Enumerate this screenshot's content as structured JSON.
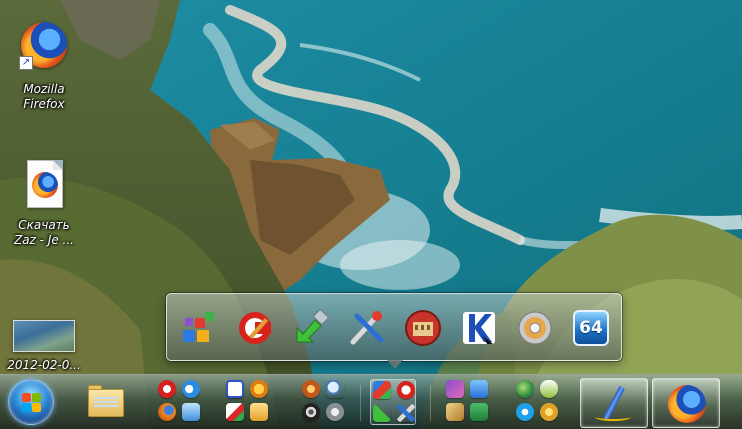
{
  "desktop": {
    "icons": [
      {
        "id": "firefox",
        "label_line1": "Mozilla",
        "label_line2": "Firefox"
      },
      {
        "id": "download",
        "label_line1": "Скачать",
        "label_line2": "Zaz - Je ..."
      },
      {
        "id": "photo",
        "label_line1": "2012-02-0...",
        "label_line2": ""
      }
    ]
  },
  "taskbar": {
    "start_button": "start-orb-icon",
    "pinned_folder": "explorer-folder-icon",
    "groups": [
      {
        "id": "browsers",
        "icons": [
          "opera-icon",
          "internet-explorer-icon",
          "firefox-icon",
          "audio-icon"
        ]
      },
      {
        "id": "tools",
        "icons": [
          "daemon-tools-icon",
          "aimp-icon",
          "pdf-icon",
          "archive-icon"
        ]
      },
      {
        "id": "media",
        "icons": [
          "media-player-icon",
          "search-icon",
          "film-reel-icon",
          "settings-icon"
        ]
      },
      {
        "id": "utilities",
        "icons": [
          "revo-uninstaller-icon",
          "ccleaner-icon",
          "usb-eject-icon",
          "tools-icon"
        ]
      },
      {
        "id": "games",
        "icons": [
          "game-icon",
          "book-icon",
          "puzzle-icon",
          "chess-icon"
        ]
      },
      {
        "id": "internet",
        "icons": [
          "globe-icon",
          "shield-icon",
          "skype-icon",
          "gear-icon"
        ]
      }
    ],
    "running_apps": [
      "pen-editor-icon",
      "firefox-icon"
    ]
  },
  "popup": {
    "icons": [
      "revo-uninstaller-icon",
      "ccleaner-icon",
      "usb-safely-remove-icon",
      "system-tools-icon",
      "colosseum-icon",
      "kaspersky-icon",
      "disc-burner-icon",
      "aida64-icon"
    ],
    "aida64_badge": "64"
  }
}
